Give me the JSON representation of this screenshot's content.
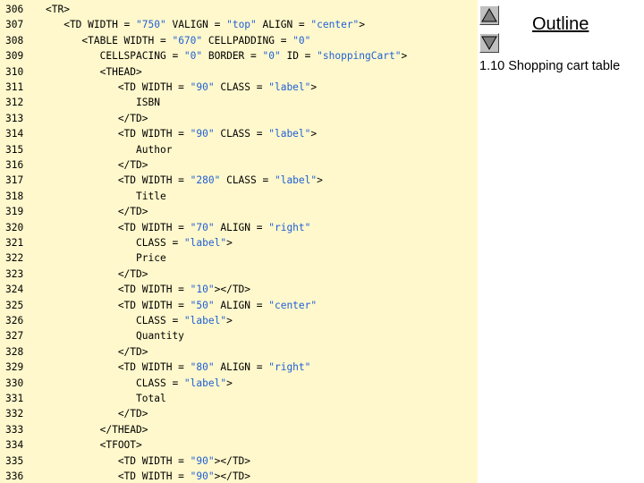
{
  "code_lines": [
    {
      "num": "306",
      "segs": [
        [
          "tag",
          "<TR>"
        ]
      ]
    },
    {
      "num": "307",
      "segs": [
        [
          "tag",
          "   <TD WIDTH = "
        ],
        [
          "str",
          "\"750\""
        ],
        [
          "tag",
          " VALIGN = "
        ],
        [
          "str",
          "\"top\""
        ],
        [
          "tag",
          " ALIGN = "
        ],
        [
          "str",
          "\"center\""
        ],
        [
          "tag",
          ">"
        ]
      ]
    },
    {
      "num": "308",
      "segs": [
        [
          "tag",
          "      <TABLE WIDTH = "
        ],
        [
          "str",
          "\"670\""
        ],
        [
          "tag",
          " CELLPADDING = "
        ],
        [
          "str",
          "\"0\""
        ]
      ]
    },
    {
      "num": "309",
      "segs": [
        [
          "tag",
          "         CELLSPACING = "
        ],
        [
          "str",
          "\"0\""
        ],
        [
          "tag",
          " BORDER = "
        ],
        [
          "str",
          "\"0\""
        ],
        [
          "tag",
          " ID = "
        ],
        [
          "str",
          "\"shoppingCart\""
        ],
        [
          "tag",
          ">"
        ]
      ]
    },
    {
      "num": "310",
      "segs": [
        [
          "tag",
          "         <THEAD>"
        ]
      ]
    },
    {
      "num": "311",
      "segs": [
        [
          "tag",
          "            <TD WIDTH = "
        ],
        [
          "str",
          "\"90\""
        ],
        [
          "tag",
          " CLASS = "
        ],
        [
          "str",
          "\"label\""
        ],
        [
          "tag",
          ">"
        ]
      ]
    },
    {
      "num": "312",
      "segs": [
        [
          "tag",
          "               ISBN"
        ]
      ]
    },
    {
      "num": "313",
      "segs": [
        [
          "tag",
          "            </TD>"
        ]
      ]
    },
    {
      "num": "314",
      "segs": [
        [
          "tag",
          "            <TD WIDTH = "
        ],
        [
          "str",
          "\"90\""
        ],
        [
          "tag",
          " CLASS = "
        ],
        [
          "str",
          "\"label\""
        ],
        [
          "tag",
          ">"
        ]
      ]
    },
    {
      "num": "315",
      "segs": [
        [
          "tag",
          "               Author"
        ]
      ]
    },
    {
      "num": "316",
      "segs": [
        [
          "tag",
          "            </TD>"
        ]
      ]
    },
    {
      "num": "317",
      "segs": [
        [
          "tag",
          "            <TD WIDTH = "
        ],
        [
          "str",
          "\"280\""
        ],
        [
          "tag",
          " CLASS = "
        ],
        [
          "str",
          "\"label\""
        ],
        [
          "tag",
          ">"
        ]
      ]
    },
    {
      "num": "318",
      "segs": [
        [
          "tag",
          "               Title"
        ]
      ]
    },
    {
      "num": "319",
      "segs": [
        [
          "tag",
          "            </TD>"
        ]
      ]
    },
    {
      "num": "320",
      "segs": [
        [
          "tag",
          "            <TD WIDTH = "
        ],
        [
          "str",
          "\"70\""
        ],
        [
          "tag",
          " ALIGN = "
        ],
        [
          "str",
          "\"right\""
        ]
      ]
    },
    {
      "num": "321",
      "segs": [
        [
          "tag",
          "               CLASS = "
        ],
        [
          "str",
          "\"label\""
        ],
        [
          "tag",
          ">"
        ]
      ]
    },
    {
      "num": "322",
      "segs": [
        [
          "tag",
          "               Price"
        ]
      ]
    },
    {
      "num": "323",
      "segs": [
        [
          "tag",
          "            </TD>"
        ]
      ]
    },
    {
      "num": "324",
      "segs": [
        [
          "tag",
          "            <TD WIDTH = "
        ],
        [
          "str",
          "\"10\""
        ],
        [
          "tag",
          "></TD>"
        ]
      ]
    },
    {
      "num": "325",
      "segs": [
        [
          "tag",
          "            <TD WIDTH = "
        ],
        [
          "str",
          "\"50\""
        ],
        [
          "tag",
          " ALIGN = "
        ],
        [
          "str",
          "\"center\""
        ]
      ]
    },
    {
      "num": "326",
      "segs": [
        [
          "tag",
          "               CLASS = "
        ],
        [
          "str",
          "\"label\""
        ],
        [
          "tag",
          ">"
        ]
      ]
    },
    {
      "num": "327",
      "segs": [
        [
          "tag",
          "               Quantity"
        ]
      ]
    },
    {
      "num": "328",
      "segs": [
        [
          "tag",
          "            </TD>"
        ]
      ]
    },
    {
      "num": "329",
      "segs": [
        [
          "tag",
          "            <TD WIDTH = "
        ],
        [
          "str",
          "\"80\""
        ],
        [
          "tag",
          " ALIGN = "
        ],
        [
          "str",
          "\"right\""
        ]
      ]
    },
    {
      "num": "330",
      "segs": [
        [
          "tag",
          "               CLASS = "
        ],
        [
          "str",
          "\"label\""
        ],
        [
          "tag",
          ">"
        ]
      ]
    },
    {
      "num": "331",
      "segs": [
        [
          "tag",
          "               Total"
        ]
      ]
    },
    {
      "num": "332",
      "segs": [
        [
          "tag",
          "            </TD>"
        ]
      ]
    },
    {
      "num": "333",
      "segs": [
        [
          "tag",
          "         </THEAD>"
        ]
      ]
    },
    {
      "num": "334",
      "segs": [
        [
          "tag",
          "         <TFOOT>"
        ]
      ]
    },
    {
      "num": "335",
      "segs": [
        [
          "tag",
          "            <TD WIDTH = "
        ],
        [
          "str",
          "\"90\""
        ],
        [
          "tag",
          "></TD>"
        ]
      ]
    },
    {
      "num": "336",
      "segs": [
        [
          "tag",
          "            <TD WIDTH = "
        ],
        [
          "str",
          "\"90\""
        ],
        [
          "tag",
          "></TD>"
        ]
      ]
    }
  ],
  "sidebar": {
    "outline_title": "Outline",
    "caption": "1.10 Shopping cart table",
    "prev_icon": "triangle-up-icon",
    "next_icon": "triangle-down-icon"
  },
  "colors": {
    "code_background": "#fff8cc",
    "string_literal": "#1f5fd6",
    "tag_text": "#000000"
  }
}
